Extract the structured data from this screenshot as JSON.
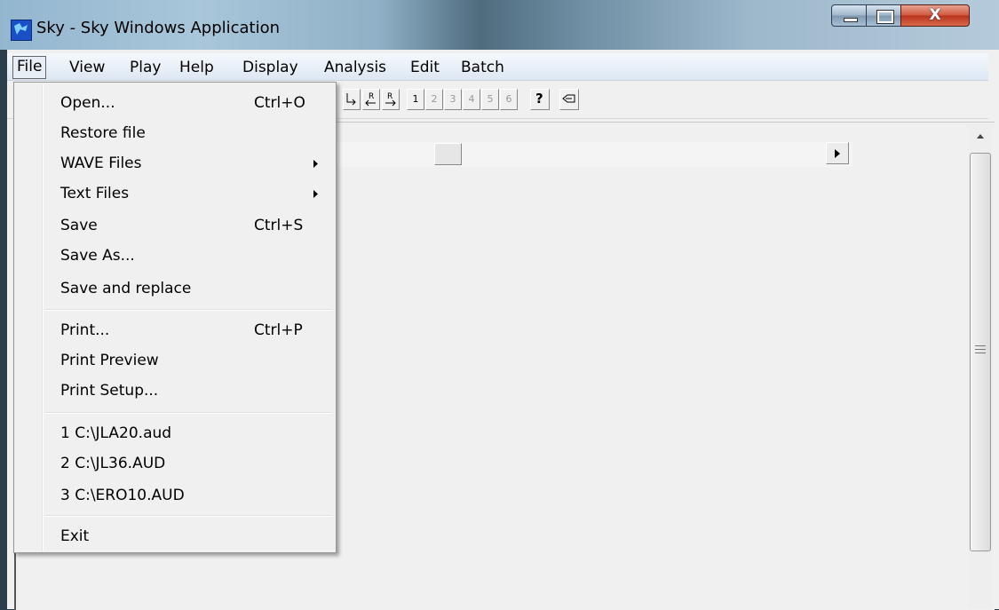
{
  "window": {
    "title": "Sky - Sky Windows Application",
    "close_glyph": "X"
  },
  "menubar": {
    "items": [
      "File",
      "View",
      "Play",
      "Help",
      "Display",
      "Analysis",
      "Edit",
      "Batch"
    ],
    "active": "File"
  },
  "toolbar": {
    "buttons": [
      "1",
      "2",
      "3",
      "4",
      "5",
      "6"
    ],
    "enabled_numbers": [
      "1"
    ],
    "icons": [
      "left-arrow-icon",
      "r-left-icon",
      "r-right-icon",
      "help-icon",
      "flag-icon"
    ]
  },
  "file_menu": {
    "items": [
      {
        "label": "Open...",
        "shortcut": "Ctrl+O"
      },
      {
        "label": "Restore file",
        "shortcut": ""
      },
      {
        "label": "WAVE Files",
        "submenu": true
      },
      {
        "label": "Text Files",
        "submenu": true
      },
      {
        "label": "Save",
        "shortcut": "Ctrl+S"
      },
      {
        "label": "Save As...",
        "shortcut": ""
      },
      {
        "label": "Save and replace",
        "shortcut": ""
      },
      {
        "label": "Print...",
        "shortcut": "Ctrl+P"
      },
      {
        "label": "Print Preview",
        "shortcut": ""
      },
      {
        "label": "Print Setup...",
        "shortcut": ""
      },
      {
        "label": "1 C:\\JLA20.aud",
        "shortcut": ""
      },
      {
        "label": "2 C:\\JL36.AUD",
        "shortcut": ""
      },
      {
        "label": "3 C:\\ERO10.AUD",
        "shortcut": ""
      },
      {
        "label": "Exit",
        "shortcut": ""
      }
    ]
  },
  "colors": {
    "close_button": "#c8452c",
    "app_icon": "#1a4fc8"
  }
}
